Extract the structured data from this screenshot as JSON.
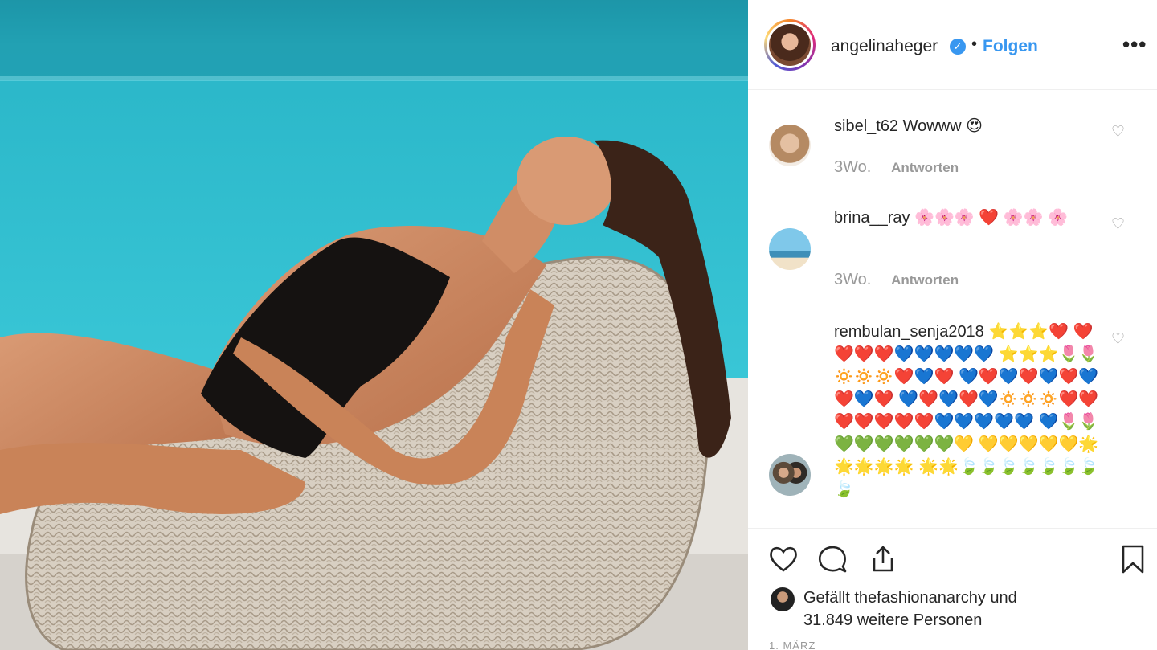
{
  "post": {
    "username": "angelinaheger",
    "verified_mark": "✓",
    "separator": "•",
    "follow_label": "Folgen",
    "more_label": "•••"
  },
  "comments": [
    {
      "user": "sibel_t62",
      "text": "Wowww 😍",
      "time": "3Wo.",
      "reply": "Antworten"
    },
    {
      "user": "brina__ray",
      "text": "🌸🌸🌸 ❤️ 🌸🌸 🌸",
      "time": "3Wo.",
      "reply": "Antworten"
    },
    {
      "user": "rembulan_senja2018",
      "text": "⭐⭐⭐❤️ ❤️❤️❤️❤️💙💙💙💙💙 ⭐⭐⭐🌷🌷🔅🔅🔅❤️💙❤️ 💙❤️💙❤️💙❤️💙❤️💙❤️ 💙❤️💙❤️💙🔅🔅🔅❤️❤️ ❤️❤️❤️❤️❤️💙💙💙💙💙 💙🌷🌷💚💚💚💚💚💚💛 💛💛💛💛💛🌟🌟🌟🌟🌟 🌟🌟🍃🍃🍃🍃🍃🍃🍃🍃"
    }
  ],
  "actions": {
    "like_icon": "heart-icon",
    "comment_icon": "comment-icon",
    "share_icon": "share-icon",
    "save_icon": "bookmark-icon"
  },
  "likes": {
    "prefix": "Gefällt",
    "liker": "thefashionanarchy",
    "suffix": "und",
    "count_text": "31.849 weitere Personen"
  },
  "date": "1. MÄRZ",
  "colors": {
    "link": "#3897f0",
    "muted": "#999999",
    "pool": "#2bbfcf"
  }
}
